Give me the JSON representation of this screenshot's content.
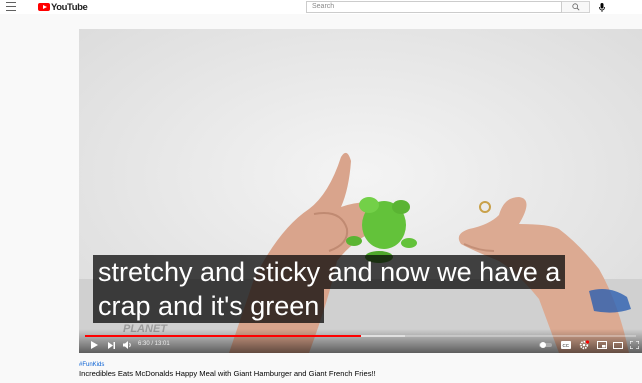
{
  "masthead": {
    "logo_text": "YouTube",
    "search_placeholder": "Search"
  },
  "player": {
    "captions": [
      "stretchy and sticky and now we have a",
      "crap and it's green"
    ],
    "time_display": "6:30 / 13:01",
    "progress_played_fraction": 0.5,
    "progress_loaded_fraction": 0.58,
    "watermark_text": [
      "PLANET"
    ]
  },
  "video": {
    "hashtag": "#FunKids",
    "title": "Incredibles Eats McDonalds Happy Meal with Giant Hamburger and Giant French Fries!!"
  },
  "colors": {
    "brand_red": "#ff0000",
    "link_blue": "#065fd4"
  }
}
